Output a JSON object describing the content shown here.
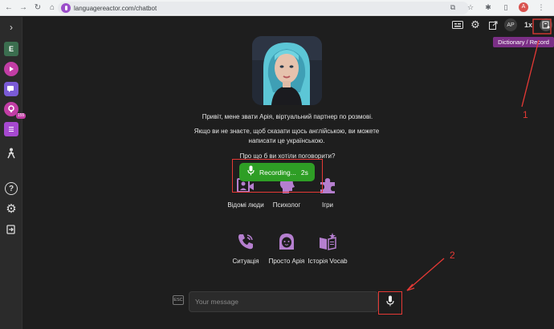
{
  "browser": {
    "url": "languagereactor.com/chatbot",
    "profile_initial": "A"
  },
  "sidebar": {
    "collapse_glyph": "›",
    "items": [
      {
        "label": "E",
        "icon": "e-badge-icon"
      },
      {
        "icon": "play-icon",
        "color": "#c23da5"
      },
      {
        "icon": "chat-icon",
        "color": "#7a5bd6"
      },
      {
        "icon": "dictionary-icon",
        "color": "#c23da5",
        "badge": "155"
      },
      {
        "icon": "list-icon",
        "color": "#a649d0"
      },
      {
        "icon": "person-icon"
      },
      {
        "icon": "help-icon"
      },
      {
        "icon": "settings-icon"
      },
      {
        "icon": "logout-icon"
      }
    ]
  },
  "topbar": {
    "ap_label": "AP",
    "speed_label": "1x",
    "tooltip": "Dictionary / Record"
  },
  "intro": {
    "line1": "Привіт, мене звати Арія, віртуальний партнер по розмові.",
    "line2": "Якщо ви не знаєте, щоб сказати щось англійською, ви можете написати це українською.",
    "line3": "Про що б ви хотіли поговорити?"
  },
  "topics": [
    {
      "label": "Відомі люди",
      "icon": "famous-people-icon"
    },
    {
      "label": "Психолог",
      "icon": "psychologist-icon"
    },
    {
      "label": "Ігри",
      "icon": "puzzle-icon"
    },
    {
      "label": "Ситуація",
      "icon": "phone-situation-icon"
    },
    {
      "label": "Просто Арія",
      "icon": "aria-face-icon"
    },
    {
      "label": "Історія Vocab",
      "icon": "book-star-icon"
    }
  ],
  "recording": {
    "label": "Recording...",
    "elapsed": "2s"
  },
  "composer": {
    "esc_label": "ESC",
    "placeholder": "Your message"
  },
  "annotations": {
    "one": "1",
    "two": "2"
  },
  "colors": {
    "accent": "#9b4dca",
    "recording_green": "#2e9e25",
    "annotation_red": "#e53935",
    "background": "#1e1e1e"
  }
}
